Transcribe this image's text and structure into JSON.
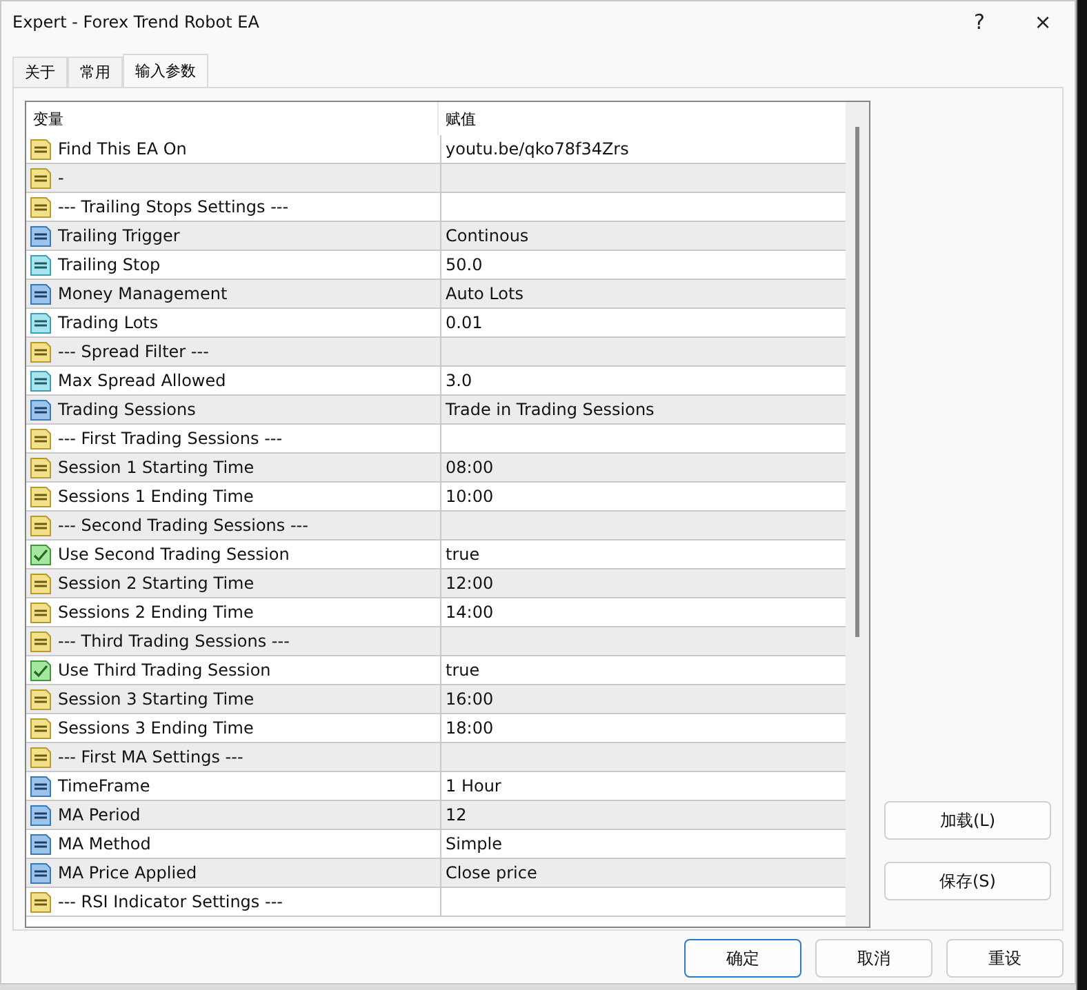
{
  "window": {
    "title": "Expert - Forex Trend Robot EA",
    "help": "?",
    "close": "×"
  },
  "tabs": [
    {
      "label": "关于",
      "selected": false
    },
    {
      "label": "常用",
      "selected": false
    },
    {
      "label": "输入参数",
      "selected": true
    }
  ],
  "table": {
    "columns": [
      "变量",
      "赋值"
    ],
    "rows": [
      {
        "kind": "string",
        "name": "Find This EA On",
        "value": "youtu.be/qko78f34Zrs"
      },
      {
        "kind": "string",
        "name": "-",
        "value": ""
      },
      {
        "kind": "string",
        "name": "--- Trailing Stops Settings ---",
        "value": ""
      },
      {
        "kind": "int",
        "name": "Trailing Trigger",
        "value": "Continous"
      },
      {
        "kind": "double",
        "name": "Trailing Stop",
        "value": "50.0"
      },
      {
        "kind": "int",
        "name": "Money Management",
        "value": "Auto Lots"
      },
      {
        "kind": "double",
        "name": "Trading Lots",
        "value": "0.01"
      },
      {
        "kind": "string",
        "name": "--- Spread Filter ---",
        "value": ""
      },
      {
        "kind": "double",
        "name": "Max Spread Allowed",
        "value": "3.0"
      },
      {
        "kind": "int",
        "name": "Trading Sessions",
        "value": "Trade in Trading Sessions"
      },
      {
        "kind": "string",
        "name": "--- First Trading Sessions ---",
        "value": ""
      },
      {
        "kind": "string",
        "name": "Session 1 Starting Time",
        "value": "08:00"
      },
      {
        "kind": "string",
        "name": "Sessions 1 Ending Time",
        "value": "10:00"
      },
      {
        "kind": "string",
        "name": "--- Second Trading Sessions ---",
        "value": ""
      },
      {
        "kind": "bool",
        "name": "Use Second Trading Session",
        "value": "true"
      },
      {
        "kind": "string",
        "name": "Session 2 Starting Time",
        "value": "12:00"
      },
      {
        "kind": "string",
        "name": "Sessions 2 Ending Time",
        "value": "14:00"
      },
      {
        "kind": "string",
        "name": "--- Third Trading Sessions ---",
        "value": ""
      },
      {
        "kind": "bool",
        "name": "Use Third Trading Session",
        "value": "true"
      },
      {
        "kind": "string",
        "name": "Session 3 Starting Time",
        "value": "16:00"
      },
      {
        "kind": "string",
        "name": "Sessions 3 Ending Time",
        "value": "18:00"
      },
      {
        "kind": "string",
        "name": "--- First MA Settings ---",
        "value": ""
      },
      {
        "kind": "int",
        "name": "TimeFrame",
        "value": "1 Hour"
      },
      {
        "kind": "int",
        "name": "MA Period",
        "value": "12"
      },
      {
        "kind": "int",
        "name": "MA Method",
        "value": "Simple"
      },
      {
        "kind": "int",
        "name": "MA Price Applied",
        "value": "Close price"
      },
      {
        "kind": "string",
        "name": "--- RSI Indicator Settings ---",
        "value": ""
      }
    ]
  },
  "side_buttons": [
    "加载(L)",
    "保存(S)"
  ],
  "buttons": [
    {
      "label": "确定",
      "selected": true
    },
    {
      "label": "取消",
      "selected": false
    },
    {
      "label": "重设",
      "selected": false
    }
  ]
}
